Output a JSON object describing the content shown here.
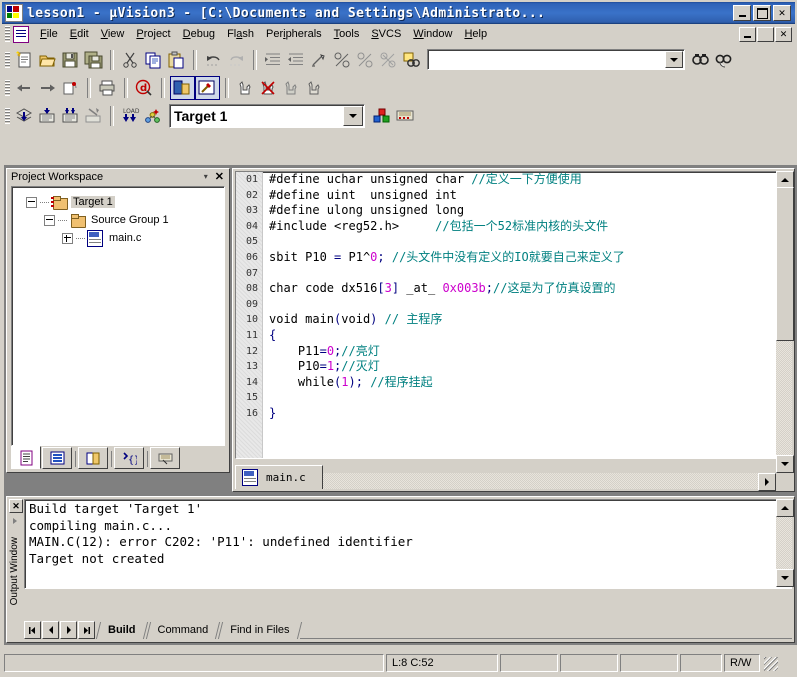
{
  "window": {
    "title": "lesson1  - µVision3 - [C:\\Documents and Settings\\Administrato...",
    "app_icon": "uvision-logo-icon",
    "buttons": {
      "minimize": "minimize-button",
      "restore": "restore-button",
      "close": "close-button"
    }
  },
  "menubar": {
    "doc_icon": "document-icon",
    "items": [
      {
        "label": "File",
        "accel": "F"
      },
      {
        "label": "Edit",
        "accel": "E"
      },
      {
        "label": "View",
        "accel": "V"
      },
      {
        "label": "Project",
        "accel": "P"
      },
      {
        "label": "Debug",
        "accel": "D"
      },
      {
        "label": "Flash",
        "accel": "a"
      },
      {
        "label": "Peripherals",
        "accel": "i"
      },
      {
        "label": "Tools",
        "accel": "T"
      },
      {
        "label": "SVCS",
        "accel": "S"
      },
      {
        "label": "Window",
        "accel": "W"
      },
      {
        "label": "Help",
        "accel": "H"
      }
    ],
    "mdi_buttons": {
      "minimize": "mdi-minimize-button",
      "restore": "mdi-restore-button",
      "close": "mdi-close-button"
    }
  },
  "toolbar_file": {
    "buttons": [
      "new-file-icon",
      "open-file-icon",
      "save-icon",
      "save-all-icon",
      "cut-icon",
      "copy-icon",
      "paste-icon",
      "undo-icon",
      "redo-icon",
      "indent-icon",
      "outdent-icon",
      "toggle-bookmark-icon",
      "next-bookmark-icon",
      "previous-bookmark-icon",
      "clear-bookmarks-icon",
      "find-in-files-icon"
    ],
    "find_box": {
      "value": "",
      "placeholder": ""
    },
    "find_buttons": [
      "find-icon",
      "incremental-find-icon"
    ]
  },
  "toolbar_nav": {
    "buttons": [
      "back-icon",
      "forward-icon",
      "goto-definition-icon",
      "print-icon",
      "debug-d-icon",
      "project-window-icon",
      "build-window-icon",
      "insert-breakpoint-icon",
      "kill-all-breakpoints-icon",
      "disable-breakpoint-icon",
      "enable-breakpoint-icon"
    ]
  },
  "toolbar_build": {
    "buttons": [
      "translate-file-icon",
      "build-target-icon",
      "rebuild-all-icon",
      "stop-build-icon",
      "download-to-flash-icon",
      "target-options-icon"
    ],
    "target_combo": {
      "value": "Target 1",
      "arrow": "chevron-down-icon"
    },
    "right_buttons": [
      "manage-components-icon",
      "remove-icon"
    ]
  },
  "project_workspace": {
    "title": "Project Workspace",
    "dropdown_icon": "chevron-down-icon",
    "close_icon": "close-icon",
    "tree": [
      {
        "label": "Target 1",
        "toggle": "minus",
        "icon": "target-folder-icon",
        "depth": 0,
        "selected": true
      },
      {
        "label": "Source Group 1",
        "toggle": "minus",
        "icon": "folder-icon",
        "depth": 1,
        "selected": false
      },
      {
        "label": "main.c",
        "toggle": "plus",
        "icon": "c-file-icon",
        "depth": 2,
        "selected": false
      }
    ],
    "tabs": [
      {
        "name": "files-tab",
        "icon": "file-page-icon",
        "active": true
      },
      {
        "name": "regs-tab",
        "icon": "list-icon",
        "active": false
      },
      {
        "name": "books-tab",
        "icon": "book-icon",
        "active": false
      },
      {
        "name": "functions-tab",
        "icon": "braces-icon",
        "active": false
      },
      {
        "name": "templates-tab",
        "icon": "template-icon",
        "active": false
      }
    ]
  },
  "editor": {
    "tab": {
      "label": "main.c",
      "icon": "c-file-icon",
      "active": true
    },
    "line_numbers": [
      "01",
      "02",
      "03",
      "04",
      "05",
      "06",
      "07",
      "08",
      "09",
      "10",
      "11",
      "12",
      "13",
      "14",
      "15",
      "16"
    ],
    "lines": [
      [
        {
          "t": "#define uchar unsigned char ",
          "c": "plain"
        },
        {
          "t": "//定义一下方便使用",
          "c": "comment"
        }
      ],
      [
        {
          "t": "#define uint  unsigned int",
          "c": "plain"
        }
      ],
      [
        {
          "t": "#define ulong unsigned long",
          "c": "plain"
        }
      ],
      [
        {
          "t": "#include <reg52.h>     ",
          "c": "plain"
        },
        {
          "t": "//包括一个52标准内核的头文件",
          "c": "comment"
        }
      ],
      [
        {
          "t": "",
          "c": "plain"
        }
      ],
      [
        {
          "t": "sbit P10 ",
          "c": "plain"
        },
        {
          "t": "=",
          "c": "keyword"
        },
        {
          "t": " P1^",
          "c": "plain"
        },
        {
          "t": "0",
          "c": "number"
        },
        {
          "t": "; ",
          "c": "keyword"
        },
        {
          "t": "//头文件中没有定义的IO就要自己来定义了",
          "c": "comment"
        }
      ],
      [
        {
          "t": "",
          "c": "plain"
        }
      ],
      [
        {
          "t": "char code dx516",
          "c": "plain"
        },
        {
          "t": "[",
          "c": "keyword"
        },
        {
          "t": "3",
          "c": "number"
        },
        {
          "t": "]",
          "c": "keyword"
        },
        {
          "t": " _at_ ",
          "c": "plain"
        },
        {
          "t": "0x003b",
          "c": "number"
        },
        {
          "t": ";",
          "c": "keyword"
        },
        {
          "t": "//这是为了仿真设置的",
          "c": "comment"
        }
      ],
      [
        {
          "t": "",
          "c": "plain"
        }
      ],
      [
        {
          "t": "void main",
          "c": "plain"
        },
        {
          "t": "(",
          "c": "keyword"
        },
        {
          "t": "void",
          "c": "plain"
        },
        {
          "t": ")",
          "c": "keyword"
        },
        {
          "t": " ",
          "c": "plain"
        },
        {
          "t": "// 主程序",
          "c": "comment"
        }
      ],
      [
        {
          "t": "{",
          "c": "keyword"
        }
      ],
      [
        {
          "t": "    P11",
          "c": "plain"
        },
        {
          "t": "=",
          "c": "keyword"
        },
        {
          "t": "0",
          "c": "number"
        },
        {
          "t": ";",
          "c": "keyword"
        },
        {
          "t": "//亮灯",
          "c": "comment"
        }
      ],
      [
        {
          "t": "    P10",
          "c": "plain"
        },
        {
          "t": "=",
          "c": "keyword"
        },
        {
          "t": "1",
          "c": "number"
        },
        {
          "t": ";",
          "c": "keyword"
        },
        {
          "t": "//灭灯",
          "c": "comment"
        }
      ],
      [
        {
          "t": "    while",
          "c": "plain"
        },
        {
          "t": "(",
          "c": "keyword"
        },
        {
          "t": "1",
          "c": "number"
        },
        {
          "t": "); ",
          "c": "keyword"
        },
        {
          "t": "//程序挂起",
          "c": "comment"
        }
      ],
      [
        {
          "t": "",
          "c": "plain"
        }
      ],
      [
        {
          "t": "}",
          "c": "keyword"
        }
      ]
    ],
    "scroll": {
      "up_icon": "scroll-up-arrow-icon",
      "down_icon": "scroll-down-arrow-icon",
      "left_icon": "scroll-left-arrow-icon",
      "right_icon": "scroll-right-arrow-icon"
    }
  },
  "output_window": {
    "close_icon": "close-icon",
    "menu_icon": "pane-menu-icon",
    "vertical_label": "Output Window",
    "lines": [
      "Build target 'Target 1'",
      "compiling main.c...",
      "MAIN.C(12): error C202: 'P11': undefined identifier",
      "Target not created"
    ],
    "nav_buttons": [
      "first-tab-icon",
      "previous-tab-icon",
      "next-tab-icon",
      "last-tab-icon"
    ],
    "tabs": [
      {
        "label": "Build",
        "active": true
      },
      {
        "label": "Command",
        "active": false
      },
      {
        "label": "Find in Files",
        "active": false
      }
    ],
    "scroll": {
      "up_icon": "scroll-up-arrow-icon",
      "down_icon": "scroll-down-arrow-icon"
    }
  },
  "statusbar": {
    "message": "",
    "cursor_position": "L:8 C:52",
    "slot1": "",
    "slot2": "",
    "slot3": "",
    "slot4": "",
    "mode": "R/W",
    "resize_grip": "resize-grip-icon"
  },
  "colors": {
    "titlebar_blue": "#2e62b8",
    "face": "#d4d0c8",
    "comment_teal": "#008080",
    "keyword_navy": "#000080",
    "number_magenta": "#cc00cc",
    "editor_bg": "#ffffff"
  }
}
